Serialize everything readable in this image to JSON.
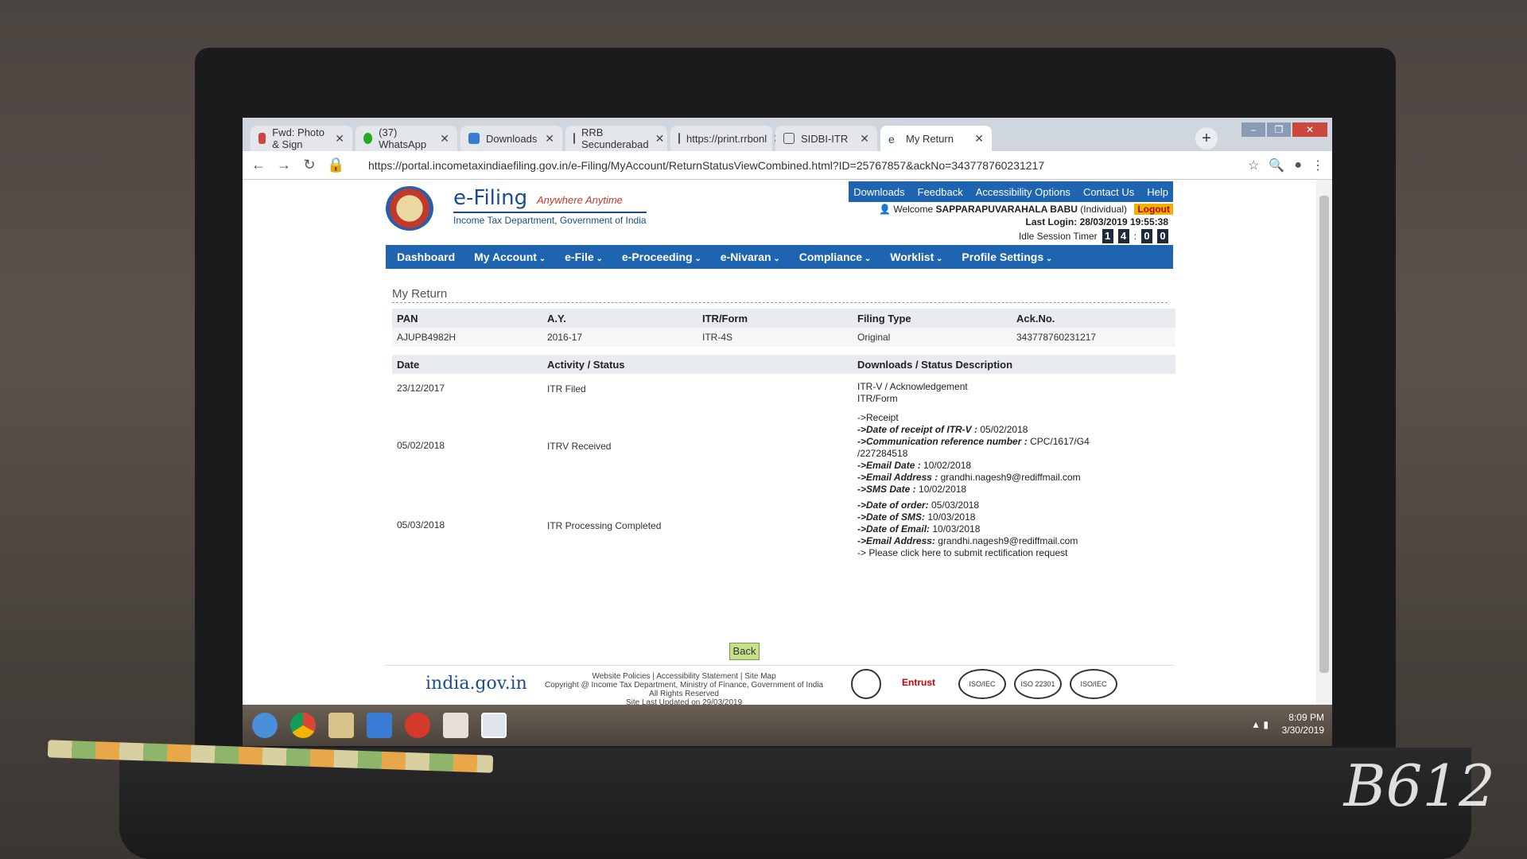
{
  "browser": {
    "tabs": [
      {
        "label": "Fwd: Photo & Sign",
        "icon": "gmail-icon"
      },
      {
        "label": "(37) WhatsApp",
        "icon": "whatsapp-icon"
      },
      {
        "label": "Downloads",
        "icon": "download-icon"
      },
      {
        "label": "RRB Secunderabad",
        "icon": "page-icon"
      },
      {
        "label": "https://print.rrbonl",
        "icon": "page-icon"
      },
      {
        "label": "SIDBI-ITR",
        "icon": "page-icon"
      },
      {
        "label": "My Return",
        "icon": "edge-icon"
      }
    ],
    "url": "https://portal.incometaxindiaefiling.gov.in/e-Filing/MyAccount/ReturnStatusViewCombined.html?ID=25767857&ackNo=343778760231217"
  },
  "site": {
    "brand": "e-Filing",
    "tagline": "Anywhere Anytime",
    "dept": "Income Tax Department, Government of India",
    "toplinks": [
      "Downloads",
      "Feedback",
      "Accessibility Options",
      "Contact Us",
      "Help"
    ],
    "welcome_prefix": "Welcome",
    "user": "SAPPARAPUVARAHALA BABU",
    "user_type": "(Individual)",
    "logout": "Logout",
    "last_login_label": "Last Login:",
    "last_login": "28/03/2019 19:55:38",
    "idle_label": "Idle Session Timer",
    "idle_digits": [
      "1",
      "4",
      "0",
      "0"
    ],
    "nav": [
      {
        "label": "Dashboard",
        "dd": false
      },
      {
        "label": "My Account",
        "dd": true
      },
      {
        "label": "e-File",
        "dd": true
      },
      {
        "label": "e-Proceeding",
        "dd": true
      },
      {
        "label": "e-Nivaran",
        "dd": true
      },
      {
        "label": "Compliance",
        "dd": true
      },
      {
        "label": "Worklist",
        "dd": true
      },
      {
        "label": "Profile Settings",
        "dd": true
      }
    ]
  },
  "return": {
    "title": "My Return",
    "headers": [
      "PAN",
      "A.Y.",
      "ITR/Form",
      "Filing Type",
      "Ack.No."
    ],
    "row": [
      "AJUPB4982H",
      "2016-17",
      "ITR-4S",
      "Original",
      "343778760231217"
    ],
    "status_headers": [
      "Date",
      "Activity / Status",
      "Downloads / Status Description"
    ],
    "entries": [
      {
        "date": "23/12/2017",
        "activity": "ITR Filed"
      },
      {
        "date": "05/02/2018",
        "activity": "ITRV Received"
      },
      {
        "date": "05/03/2018",
        "activity": "ITR Processing Completed"
      }
    ],
    "desc1": [
      "ITR-V / Acknowledgement",
      "ITR/Form"
    ],
    "desc2": {
      "receipt": "->Receipt",
      "date_receipt_label": "->Date of receipt of ITR-V :",
      "date_receipt": "05/02/2018",
      "comm_ref_label": "->Communication reference number :",
      "comm_ref": "CPC/1617/G4",
      "comm_ref_cont": "/227284518",
      "email_date_label": "->Email Date :",
      "email_date": "10/02/2018",
      "email_addr_label": "->Email Address :",
      "email_addr": "grandhi.nagesh9@rediffmail.com",
      "sms_date_label": "->SMS Date :",
      "sms_date": "10/02/2018"
    },
    "desc3": {
      "order_label": "->Date of order:",
      "order": "05/03/2018",
      "sms_label": "->Date of SMS:",
      "sms": "10/03/2018",
      "email_label": "->Date of Email:",
      "email": "10/03/2018",
      "email_addr_label": "->Email Address:",
      "email_addr": "grandhi.nagesh9@rediffmail.com",
      "rectify": "-> Please click here to submit rectification request"
    },
    "back": "Back"
  },
  "footer": {
    "indiagov": "india.gov.in",
    "links": "Website Policies  |  Accessibility Statement  |  Site Map",
    "copyright": "Copyright @ Income Tax Department, Ministry of Finance, Government of India",
    "rights": "All Rights Reserved",
    "updated": "Site Last Updated on 29/03/2019",
    "badges": [
      "Entrust",
      "ISO/IEC 20000-1",
      "ISO 22301",
      "ISO/IEC 27001"
    ]
  },
  "taskbar": {
    "time": "8:09 PM",
    "date": "3/30/2019"
  },
  "watermark": "B612"
}
